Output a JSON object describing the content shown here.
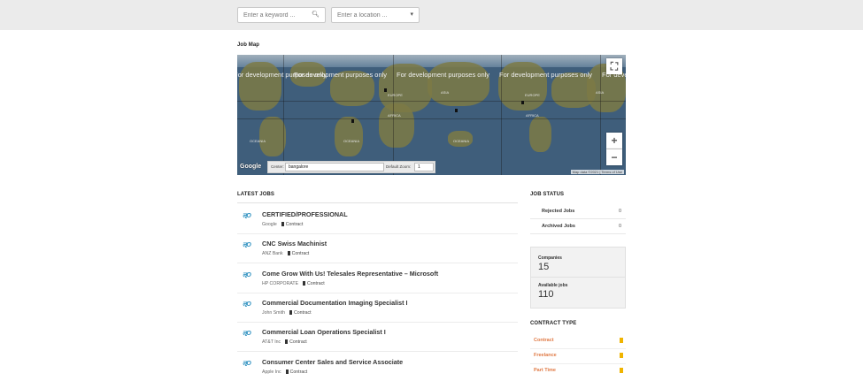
{
  "search": {
    "keyword_placeholder": "Enter a keyword ...",
    "location_placeholder": "Enter a location ..."
  },
  "map": {
    "title": "Job Map",
    "watermark": "For development purposes only",
    "labels": [
      "OCEANIA",
      "EUROPE",
      "AFRICA",
      "ASIA",
      "OCEANIA",
      "EUROPE",
      "AFRICA",
      "ASIA",
      "OCEANIA"
    ],
    "center_label": "Center:",
    "center_value": "bangalore",
    "zoom_label": "Default Zoom:",
    "zoom_value": "1",
    "map_data": "Map data ©2021  |  Terms of Use",
    "google": "Google"
  },
  "latest_jobs": {
    "title": "LATEST JOBS",
    "items": [
      {
        "title": "CERTIFIED/PROFESSIONAL",
        "company": "Google",
        "type": "Contract"
      },
      {
        "title": "CNC Swiss Machinist",
        "company": "ANZ Bank",
        "type": "Contract"
      },
      {
        "title": "Come Grow With Us! Telesales Representative – Microsoft",
        "company": "HP CORPORATE",
        "type": "Contract"
      },
      {
        "title": "Commercial Documentation Imaging Specialist I",
        "company": "John Smith",
        "type": "Contract"
      },
      {
        "title": "Commercial Loan Operations Specialist I",
        "company": "AT&T Inc",
        "type": "Contract"
      },
      {
        "title": "Consumer Center Sales and Service Associate",
        "company": "Apple Inc",
        "type": "Contract"
      }
    ],
    "logo_text": "ऌO"
  },
  "job_status": {
    "title": "JOB STATUS",
    "rows": [
      {
        "label": "Rejected Jobs",
        "value": "0"
      },
      {
        "label": "Archived Jobs",
        "value": "0"
      }
    ]
  },
  "stats": {
    "companies_label": "Companies",
    "companies_value": "15",
    "available_label": "Available jobs",
    "available_value": "110"
  },
  "contract_type": {
    "title": "CONTRACT TYPE",
    "items": [
      "Contract",
      "Freelance",
      "Part Time"
    ]
  },
  "icons": {
    "search": "search-icon",
    "location": "pin-icon",
    "fullscreen": "fullscreen-icon",
    "zoom_in": "plus-icon",
    "zoom_out": "minus-icon",
    "bookmark": "bookmark-icon"
  }
}
